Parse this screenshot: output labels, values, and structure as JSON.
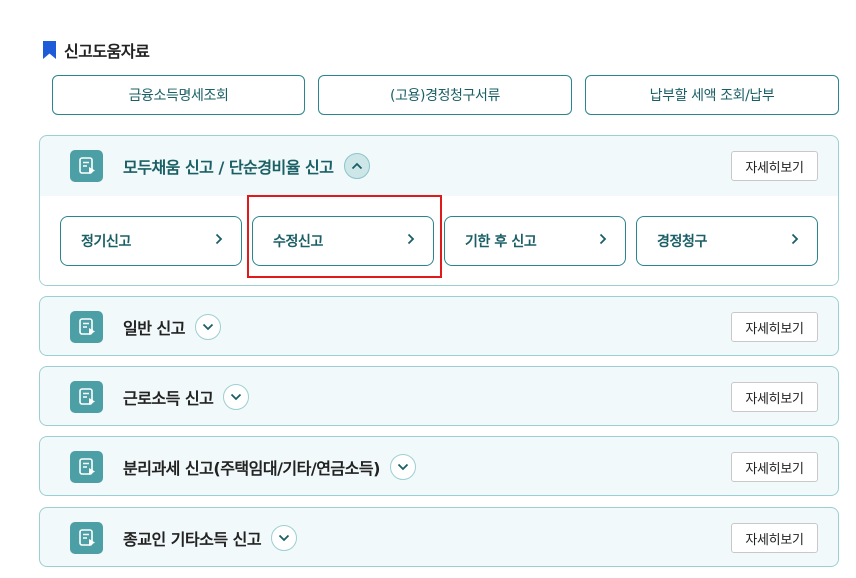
{
  "section": {
    "title": "신고도움자료",
    "icon": "bookmark-icon",
    "accent": "#1e5bd8"
  },
  "quick_links": [
    {
      "label": "금융소득명세조회"
    },
    {
      "label": "(고용)경정청구서류"
    },
    {
      "label": "납부할 세액 조회/납부"
    }
  ],
  "accordions": [
    {
      "title": "모두채움 신고 / 단순경비율 신고",
      "expanded": true,
      "detail_label": "자세히보기",
      "sub_items": [
        {
          "label": "정기신고"
        },
        {
          "label": "수정신고"
        },
        {
          "label": "기한 후 신고"
        },
        {
          "label": "경정청구"
        }
      ]
    },
    {
      "title": "일반 신고",
      "expanded": false,
      "detail_label": "자세히보기"
    },
    {
      "title": "근로소득 신고",
      "expanded": false,
      "detail_label": "자세히보기"
    },
    {
      "title": "분리과세 신고(주택임대/기타/연금소득)",
      "expanded": false,
      "detail_label": "자세히보기"
    },
    {
      "title": "종교인 기타소득 신고",
      "expanded": false,
      "detail_label": "자세히보기"
    }
  ],
  "colors": {
    "teal": "#2a8590",
    "teal_light": "#f2f9fa",
    "icon_bg": "#4d9fa6",
    "highlight": "#e01a1a"
  }
}
